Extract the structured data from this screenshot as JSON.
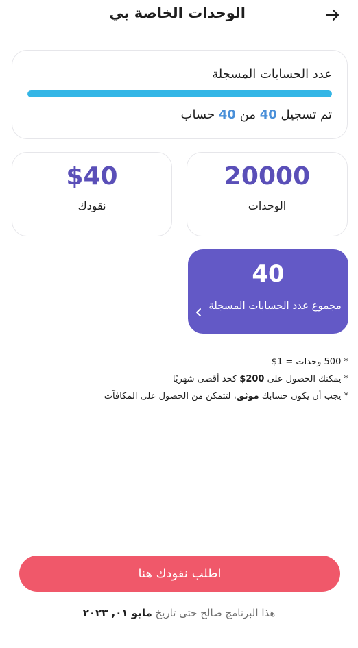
{
  "header": {
    "title": "الوحدات الخاصة بي",
    "back_icon": "arrow-right-icon"
  },
  "accounts": {
    "label": "عدد الحسابات المسجلة",
    "progress_fraction": 1.0,
    "progress_prefix": "تم تسجيل",
    "registered": "40",
    "of_word": "من",
    "total": "40",
    "suffix": "حساب",
    "bar_color": "#34b6e6"
  },
  "stats": {
    "units_value": "20000",
    "units_label": "الوحدات",
    "cash_value": "$40",
    "cash_label": "نقودك",
    "value_color": "#5a4fb8"
  },
  "total_card": {
    "value": "40",
    "label": "مجموع عدد الحسابات المسجلة",
    "chevron_icon": "chevron-left-icon",
    "bg_color": "#6359c6"
  },
  "notes": {
    "note1": "* 500 وحدات = 1$",
    "note2_pre": "* يمكنك الحصول على ",
    "note2_bold": "200$",
    "note2_post": " كحد أقصى شهريًا",
    "note3_pre": "* يجب أن يكون حسابك ",
    "note3_bold": "موثق",
    "note3_post": "، لتتمكن من الحصول على المكافآت"
  },
  "cta": {
    "label": "اطلب نقودك هنا",
    "color": "#f0586a"
  },
  "footer": {
    "text_pre": "هذا البرنامج صالح حتى تاريخ ",
    "month": "مايو",
    "date": " ٠١, ٢٠٢٣"
  }
}
